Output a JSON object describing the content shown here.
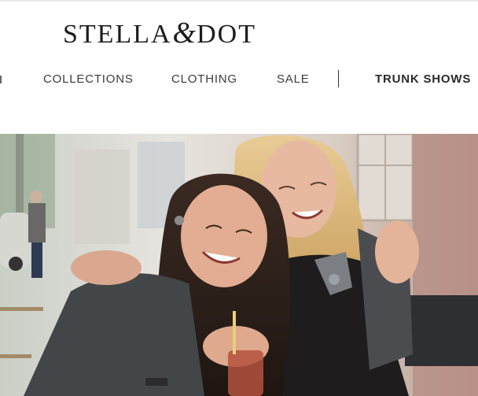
{
  "brand": {
    "logo_left": "STELLA",
    "logo_amp": "&",
    "logo_right": "DOT"
  },
  "nav": {
    "items": [
      {
        "label": "COLLECTIONS"
      },
      {
        "label": "CLOTHING"
      },
      {
        "label": "SALE"
      },
      {
        "label": "TRUNK SHOWS"
      }
    ]
  },
  "hero": {
    "image": "two-women-smiling-photo"
  },
  "colors": {
    "logo": "#1c1c1c",
    "nav_text": "#3a3a3a"
  }
}
